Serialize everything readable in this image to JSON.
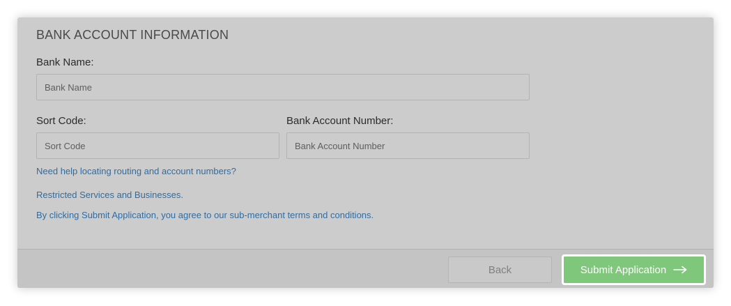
{
  "section": {
    "title": "BANK ACCOUNT INFORMATION"
  },
  "fields": {
    "bank_name": {
      "label": "Bank Name:",
      "placeholder": "Bank Name",
      "value": ""
    },
    "sort_code": {
      "label": "Sort Code:",
      "placeholder": "Sort Code",
      "value": ""
    },
    "account_number": {
      "label": "Bank Account Number:",
      "placeholder": "Bank Account Number",
      "value": ""
    }
  },
  "links": {
    "routing_help": "Need help locating routing and account numbers?",
    "restricted": "Restricted Services and Businesses.",
    "terms": "By clicking Submit Application, you agree to our sub-merchant terms and conditions."
  },
  "footer": {
    "back_label": "Back",
    "submit_label": "Submit Application",
    "submit_icon": "arrow-right-icon"
  },
  "colors": {
    "panel_bg": "#cccccc",
    "link": "#2e6da4",
    "submit_bg": "#7fc77a"
  }
}
